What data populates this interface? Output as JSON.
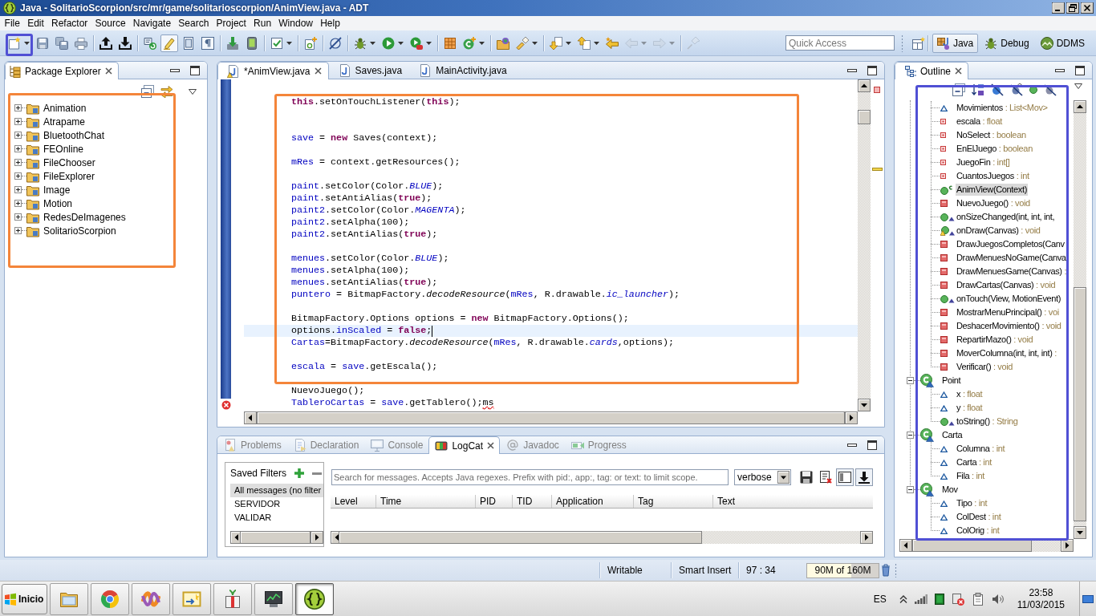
{
  "window": {
    "title": "Java - SolitarioScorpion/src/mr/game/solitarioscorpion/AnimView.java - ADT"
  },
  "menu": [
    "File",
    "Edit",
    "Refactor",
    "Source",
    "Navigate",
    "Search",
    "Project",
    "Run",
    "Window",
    "Help"
  ],
  "toolbar": {
    "groups": [
      {
        "items": [
          {
            "kind": "new",
            "dropdown": true,
            "pressed": false,
            "disabled": false,
            "framed": true
          },
          {
            "kind": "save",
            "dropdown": false,
            "pressed": false,
            "disabled": false,
            "framed": false
          },
          {
            "kind": "save-all",
            "dropdown": false,
            "pressed": false,
            "disabled": false,
            "framed": false
          },
          {
            "kind": "print",
            "dropdown": false,
            "pressed": false,
            "disabled": false,
            "framed": false
          }
        ]
      },
      {
        "items": [
          {
            "kind": "upload",
            "dropdown": false,
            "pressed": false,
            "disabled": false,
            "framed": false
          },
          {
            "kind": "download",
            "dropdown": false,
            "pressed": false,
            "disabled": false,
            "framed": false
          }
        ]
      },
      {
        "items": [
          {
            "kind": "refresh-search",
            "dropdown": false,
            "pressed": false,
            "disabled": false,
            "framed": false
          },
          {
            "kind": "highlighter",
            "dropdown": false,
            "pressed": true,
            "disabled": false,
            "framed": false
          },
          {
            "kind": "block-select",
            "dropdown": false,
            "pressed": false,
            "disabled": false,
            "framed": false
          },
          {
            "kind": "whitespace",
            "dropdown": false,
            "pressed": false,
            "disabled": false,
            "framed": false
          }
        ]
      },
      {
        "items": [
          {
            "kind": "sdk-manager",
            "dropdown": false,
            "pressed": false,
            "disabled": false,
            "framed": false
          },
          {
            "kind": "device-manager",
            "dropdown": false,
            "pressed": false,
            "disabled": false,
            "framed": false
          }
        ]
      },
      {
        "items": [
          {
            "kind": "checkbox",
            "dropdown": true,
            "pressed": false,
            "disabled": false,
            "framed": false
          }
        ]
      },
      {
        "items": [
          {
            "kind": "new-project",
            "dropdown": false,
            "pressed": false,
            "disabled": false,
            "framed": false
          }
        ]
      },
      {
        "items": [
          {
            "kind": "lint",
            "dropdown": false,
            "pressed": false,
            "disabled": false,
            "framed": false
          }
        ]
      },
      {
        "items": [
          {
            "kind": "debug",
            "dropdown": true,
            "pressed": false,
            "disabled": false,
            "framed": false
          },
          {
            "kind": "run",
            "dropdown": true,
            "pressed": false,
            "disabled": false,
            "framed": false
          },
          {
            "kind": "external-tools",
            "dropdown": true,
            "pressed": false,
            "disabled": false,
            "framed": false
          }
        ]
      },
      {
        "items": [
          {
            "kind": "new-package",
            "dropdown": false,
            "pressed": false,
            "disabled": false,
            "framed": false
          },
          {
            "kind": "new-class",
            "dropdown": true,
            "pressed": false,
            "disabled": false,
            "framed": false
          }
        ]
      },
      {
        "items": [
          {
            "kind": "open-type",
            "dropdown": false,
            "pressed": false,
            "disabled": false,
            "framed": false
          },
          {
            "kind": "search",
            "dropdown": true,
            "pressed": false,
            "disabled": false,
            "framed": false
          }
        ]
      },
      {
        "items": [
          {
            "kind": "next-annotation",
            "dropdown": true,
            "pressed": false,
            "disabled": false,
            "framed": false
          },
          {
            "kind": "previous-annotation",
            "dropdown": true,
            "pressed": false,
            "disabled": false,
            "framed": false
          },
          {
            "kind": "last-edit",
            "dropdown": false,
            "pressed": false,
            "disabled": false,
            "framed": false
          },
          {
            "kind": "back",
            "dropdown": true,
            "pressed": false,
            "disabled": true,
            "framed": false
          },
          {
            "kind": "forward",
            "dropdown": true,
            "pressed": false,
            "disabled": true,
            "framed": false
          }
        ]
      },
      {
        "items": [
          {
            "kind": "pin",
            "dropdown": false,
            "pressed": false,
            "disabled": true,
            "framed": false
          }
        ]
      }
    ],
    "quick_access": {
      "placeholder": "Quick Access"
    },
    "perspectives": [
      {
        "kind": "java",
        "label": "Java",
        "selected": true
      },
      {
        "kind": "debug",
        "label": "Debug",
        "selected": false
      },
      {
        "kind": "ddms",
        "label": "DDMS",
        "selected": false
      }
    ]
  },
  "package_explorer": {
    "title": "Package Explorer",
    "framed": true,
    "projects": [
      {
        "label": "Animation",
        "expanded": false
      },
      {
        "label": "Atrapame",
        "expanded": false
      },
      {
        "label": "BluetoothChat",
        "expanded": false
      },
      {
        "label": "FEOnline",
        "expanded": false
      },
      {
        "label": "FileChooser",
        "expanded": false
      },
      {
        "label": "FileExplorer",
        "expanded": false
      },
      {
        "label": "Image",
        "expanded": false
      },
      {
        "label": "Motion",
        "expanded": false
      },
      {
        "label": "RedesDeImagenes",
        "expanded": false
      },
      {
        "label": "SolitarioScorpion",
        "expanded": false
      }
    ]
  },
  "editor": {
    "tabs": [
      {
        "label": "*AnimView.java",
        "selected": true,
        "warning": true
      },
      {
        "label": "Saves.java",
        "selected": false,
        "warning": false
      },
      {
        "label": "MainActivity.java",
        "selected": false,
        "warning": false
      }
    ],
    "framed": true,
    "lines": [
      {
        "kind": "blank",
        "current": false
      },
      {
        "kind": "code",
        "current": false,
        "tokens": [
          {
            "kind": "keyword",
            "text": "this"
          },
          {
            "kind": "plain",
            "text": ".setOnTouchListener("
          },
          {
            "kind": "keyword",
            "text": "this"
          },
          {
            "kind": "plain",
            "text": ");"
          }
        ]
      },
      {
        "kind": "blank",
        "current": false
      },
      {
        "kind": "blank",
        "current": false
      },
      {
        "kind": "code",
        "current": false,
        "tokens": [
          {
            "kind": "field",
            "text": "save"
          },
          {
            "kind": "plain",
            "text": " = "
          },
          {
            "kind": "keyword",
            "text": "new"
          },
          {
            "kind": "plain",
            "text": " Saves(context);"
          }
        ]
      },
      {
        "kind": "blank",
        "current": false
      },
      {
        "kind": "code",
        "current": false,
        "tokens": [
          {
            "kind": "field",
            "text": "mRes"
          },
          {
            "kind": "plain",
            "text": " = context.getResources();"
          }
        ]
      },
      {
        "kind": "blank",
        "current": false
      },
      {
        "kind": "code",
        "current": false,
        "tokens": [
          {
            "kind": "field",
            "text": "paint"
          },
          {
            "kind": "plain",
            "text": ".setColor(Color."
          },
          {
            "kind": "constant",
            "text": "BLUE"
          },
          {
            "kind": "plain",
            "text": ");"
          }
        ]
      },
      {
        "kind": "code",
        "current": false,
        "tokens": [
          {
            "kind": "field",
            "text": "paint"
          },
          {
            "kind": "plain",
            "text": ".setAntiAlias("
          },
          {
            "kind": "keyword",
            "text": "true"
          },
          {
            "kind": "plain",
            "text": ");"
          }
        ]
      },
      {
        "kind": "code",
        "current": false,
        "tokens": [
          {
            "kind": "field",
            "text": "paint2"
          },
          {
            "kind": "plain",
            "text": ".setColor(Color."
          },
          {
            "kind": "constant",
            "text": "MAGENTA"
          },
          {
            "kind": "plain",
            "text": ");"
          }
        ]
      },
      {
        "kind": "code",
        "current": false,
        "tokens": [
          {
            "kind": "field",
            "text": "paint2"
          },
          {
            "kind": "plain",
            "text": ".setAlpha(100);"
          }
        ]
      },
      {
        "kind": "code",
        "current": false,
        "tokens": [
          {
            "kind": "field",
            "text": "paint2"
          },
          {
            "kind": "plain",
            "text": ".setAntiAlias("
          },
          {
            "kind": "keyword",
            "text": "true"
          },
          {
            "kind": "plain",
            "text": ");"
          }
        ]
      },
      {
        "kind": "blank",
        "current": false
      },
      {
        "kind": "code",
        "current": false,
        "tokens": [
          {
            "kind": "field",
            "text": "menues"
          },
          {
            "kind": "plain",
            "text": ".setColor(Color."
          },
          {
            "kind": "constant",
            "text": "BLUE"
          },
          {
            "kind": "plain",
            "text": ");"
          }
        ]
      },
      {
        "kind": "code",
        "current": false,
        "tokens": [
          {
            "kind": "field",
            "text": "menues"
          },
          {
            "kind": "plain",
            "text": ".setAlpha(100);"
          }
        ]
      },
      {
        "kind": "code",
        "current": false,
        "tokens": [
          {
            "kind": "field",
            "text": "menues"
          },
          {
            "kind": "plain",
            "text": ".setAntiAlias("
          },
          {
            "kind": "keyword",
            "text": "true"
          },
          {
            "kind": "plain",
            "text": ");"
          }
        ]
      },
      {
        "kind": "code",
        "current": false,
        "tokens": [
          {
            "kind": "field",
            "text": "puntero"
          },
          {
            "kind": "plain",
            "text": " = BitmapFactory."
          },
          {
            "kind": "static",
            "text": "decodeResource"
          },
          {
            "kind": "plain",
            "text": "("
          },
          {
            "kind": "field",
            "text": "mRes"
          },
          {
            "kind": "plain",
            "text": ", R.drawable."
          },
          {
            "kind": "constant",
            "text": "ic_launcher"
          },
          {
            "kind": "plain",
            "text": ");"
          }
        ]
      },
      {
        "kind": "blank",
        "current": false
      },
      {
        "kind": "code",
        "current": false,
        "tokens": [
          {
            "kind": "plain",
            "text": "BitmapFactory.Options options = "
          },
          {
            "kind": "keyword",
            "text": "new"
          },
          {
            "kind": "plain",
            "text": " BitmapFactory.Options();"
          }
        ]
      },
      {
        "kind": "code",
        "current": true,
        "tokens": [
          {
            "kind": "plain",
            "text": "options."
          },
          {
            "kind": "field",
            "text": "inScaled"
          },
          {
            "kind": "plain",
            "text": " = "
          },
          {
            "kind": "keyword",
            "text": "false"
          },
          {
            "kind": "plain",
            "text": ";"
          }
        ]
      },
      {
        "kind": "code",
        "current": false,
        "tokens": [
          {
            "kind": "field",
            "text": "Cartas"
          },
          {
            "kind": "plain",
            "text": "=BitmapFactory."
          },
          {
            "kind": "static",
            "text": "decodeResource"
          },
          {
            "kind": "plain",
            "text": "("
          },
          {
            "kind": "field",
            "text": "mRes"
          },
          {
            "kind": "plain",
            "text": ", R.drawable."
          },
          {
            "kind": "constant",
            "text": "cards"
          },
          {
            "kind": "plain",
            "text": ",options);"
          }
        ]
      },
      {
        "kind": "blank",
        "current": false
      },
      {
        "kind": "code",
        "current": false,
        "tokens": [
          {
            "kind": "field",
            "text": "escala"
          },
          {
            "kind": "plain",
            "text": " = "
          },
          {
            "kind": "field",
            "text": "save"
          },
          {
            "kind": "plain",
            "text": ".getEscala();"
          }
        ]
      },
      {
        "kind": "blank",
        "current": false
      },
      {
        "kind": "code",
        "current": false,
        "tokens": [
          {
            "kind": "plain",
            "text": "NuevoJuego();"
          }
        ]
      },
      {
        "kind": "code",
        "current": false,
        "tokens": [
          {
            "kind": "field",
            "text": "TableroCartas"
          },
          {
            "kind": "plain",
            "text": " = "
          },
          {
            "kind": "field",
            "text": "save"
          },
          {
            "kind": "plain",
            "text": ".getTablero();"
          },
          {
            "kind": "error",
            "text": "ms"
          }
        ]
      }
    ]
  },
  "console": {
    "tabs": [
      {
        "kind": "problems",
        "label": "Problems",
        "selected": false
      },
      {
        "kind": "declaration",
        "label": "Declaration",
        "selected": false
      },
      {
        "kind": "console",
        "label": "Console",
        "selected": false
      },
      {
        "kind": "logcat",
        "label": "LogCat",
        "selected": true
      },
      {
        "kind": "javadoc",
        "label": "Javadoc",
        "selected": false
      },
      {
        "kind": "progress",
        "label": "Progress",
        "selected": false
      }
    ],
    "saved_filters": {
      "title": "Saved Filters",
      "filters": [
        {
          "label": "All messages (no filter",
          "selected": true
        },
        {
          "label": "SERVIDOR",
          "selected": false
        },
        {
          "label": "VALIDAR",
          "selected": false
        }
      ]
    },
    "search": {
      "placeholder": "Search for messages. Accepts Java regexes. Prefix with pid:, app:, tag: or text: to limit scope."
    },
    "log_level": {
      "value": "verbose"
    },
    "actions": [
      {
        "kind": "save",
        "pressed": false
      },
      {
        "kind": "clear",
        "pressed": false
      },
      {
        "kind": "split",
        "pressed": true
      },
      {
        "kind": "scroll-lock",
        "pressed": true
      }
    ],
    "columns": [
      "Level",
      "Time",
      "PID",
      "TID",
      "Application",
      "Tag",
      "Text"
    ]
  },
  "outline": {
    "title": "Outline",
    "framed": true,
    "tree": [
      {
        "kind": "continued",
        "children": [
          {
            "kind": "default-field",
            "label": "Movimientos",
            "detail": ": List<Mov>",
            "selected": false
          },
          {
            "kind": "private-field",
            "label": "escala",
            "detail": ": float",
            "selected": false
          },
          {
            "kind": "private-field",
            "label": "NoSelect",
            "detail": ": boolean",
            "selected": false
          },
          {
            "kind": "private-field",
            "label": "EnElJuego",
            "detail": ": boolean",
            "selected": false
          },
          {
            "kind": "private-field",
            "label": "JuegoFin",
            "detail": ": int[]",
            "selected": false
          },
          {
            "kind": "private-field",
            "label": "CuantosJuegos",
            "detail": ": int",
            "selected": false
          },
          {
            "kind": "constructor",
            "label": "AnimView(Context)",
            "selected": true
          },
          {
            "kind": "private-method",
            "label": "NuevoJuego()",
            "detail": ": void",
            "selected": false
          },
          {
            "kind": "public-override",
            "label": "onSizeChanged(int, int, int,",
            "selected": false
          },
          {
            "kind": "warning-override",
            "label": "onDraw(Canvas)",
            "detail": ": void",
            "selected": false
          },
          {
            "kind": "private-method",
            "label": "DrawJuegosCompletos(Canv",
            "selected": false
          },
          {
            "kind": "private-method",
            "label": "DrawMenuesNoGame(Canva",
            "selected": false
          },
          {
            "kind": "private-method",
            "label": "DrawMenuesGame(Canvas)",
            "detail": ":",
            "selected": false
          },
          {
            "kind": "private-method",
            "label": "DrawCartas(Canvas)",
            "detail": ": void",
            "selected": false
          },
          {
            "kind": "public-override",
            "label": "onTouch(View, MotionEvent)",
            "selected": false
          },
          {
            "kind": "private-method",
            "label": "MostrarMenuPrincipal()",
            "detail": ": voi",
            "selected": false
          },
          {
            "kind": "private-method",
            "label": "DeshacerMovimiento()",
            "detail": ": void",
            "selected": false
          },
          {
            "kind": "private-method",
            "label": "RepartirMazo()",
            "detail": ": void",
            "selected": false
          },
          {
            "kind": "private-method",
            "label": "MoverColumna(int, int, int)",
            "detail": ":",
            "selected": false
          },
          {
            "kind": "private-method",
            "label": "Verificar()",
            "detail": ": void",
            "selected": false
          }
        ]
      },
      {
        "kind": "class",
        "label": "Point",
        "expanded": true,
        "selected": false,
        "children": [
          {
            "kind": "default-field",
            "label": "x",
            "detail": ": float",
            "selected": false
          },
          {
            "kind": "default-field",
            "label": "y",
            "detail": ": float",
            "selected": false
          },
          {
            "kind": "public-override",
            "label": "toString()",
            "detail": ": String",
            "selected": false
          }
        ]
      },
      {
        "kind": "class",
        "label": "Carta",
        "expanded": true,
        "selected": false,
        "children": [
          {
            "kind": "default-field",
            "label": "Columna",
            "detail": ": int",
            "selected": false
          },
          {
            "kind": "default-field",
            "label": "Carta",
            "detail": ": int",
            "selected": false
          },
          {
            "kind": "default-field",
            "label": "Fila",
            "detail": ": int",
            "selected": false
          }
        ]
      },
      {
        "kind": "class",
        "label": "Mov",
        "expanded": true,
        "selected": false,
        "children": [
          {
            "kind": "default-field",
            "label": "Tipo",
            "detail": ": int",
            "selected": false
          },
          {
            "kind": "default-field",
            "label": "ColDest",
            "detail": ": int",
            "selected": false
          },
          {
            "kind": "default-field",
            "label": "ColOrig",
            "detail": ": int",
            "selected": false
          }
        ]
      }
    ]
  },
  "status_bar": {
    "write_mode": "Writable",
    "insert_mode": "Smart Insert",
    "position": "97 : 34",
    "heap": {
      "label": "90M of 160M",
      "level": 0.62
    }
  },
  "taskbar": {
    "start_button": "Inicio",
    "apps": [
      {
        "kind": "folder",
        "selected": false
      },
      {
        "kind": "browser",
        "selected": false
      },
      {
        "kind": "ribbon",
        "selected": false
      },
      {
        "kind": "picture",
        "selected": false
      },
      {
        "kind": "gift",
        "selected": false
      },
      {
        "kind": "monitor",
        "selected": false
      },
      {
        "kind": "adt",
        "selected": true
      }
    ],
    "language": "ES",
    "clock": {
      "time": "23:58",
      "date": "11/03/2015"
    }
  }
}
